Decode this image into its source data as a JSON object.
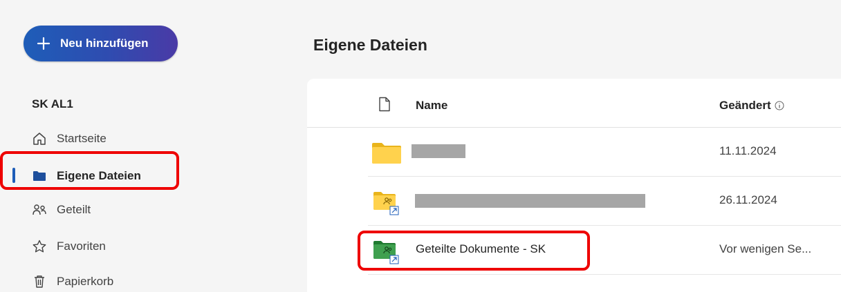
{
  "sidebar": {
    "new_button_label": "Neu hinzufügen",
    "section_title": "SK AL1",
    "items": [
      {
        "label": "Startseite",
        "icon": "home-icon"
      },
      {
        "label": "Eigene Dateien",
        "icon": "folder-icon",
        "active": true
      },
      {
        "label": "Geteilt",
        "icon": "people-icon"
      },
      {
        "label": "Favoriten",
        "icon": "star-icon"
      },
      {
        "label": "Papierkorb",
        "icon": "trash-icon"
      }
    ]
  },
  "main": {
    "title": "Eigene Dateien",
    "columns": {
      "name": "Name",
      "changed": "Geändert"
    },
    "rows": [
      {
        "name": "",
        "changed": "11.11.2024",
        "icon": "yellow-folder-icon",
        "redacted": true
      },
      {
        "name": "",
        "changed": "26.11.2024",
        "icon": "shared-yellow-folder-icon",
        "redacted": true
      },
      {
        "name": "Geteilte Dokumente - SK",
        "changed": "Vor wenigen Se...",
        "icon": "shared-green-folder-icon",
        "redacted": false
      }
    ]
  },
  "colors": {
    "accent": "#1e5db8",
    "highlight": "#ee0000",
    "folder_yellow": "#f5c518",
    "folder_green": "#2e8b3e"
  }
}
